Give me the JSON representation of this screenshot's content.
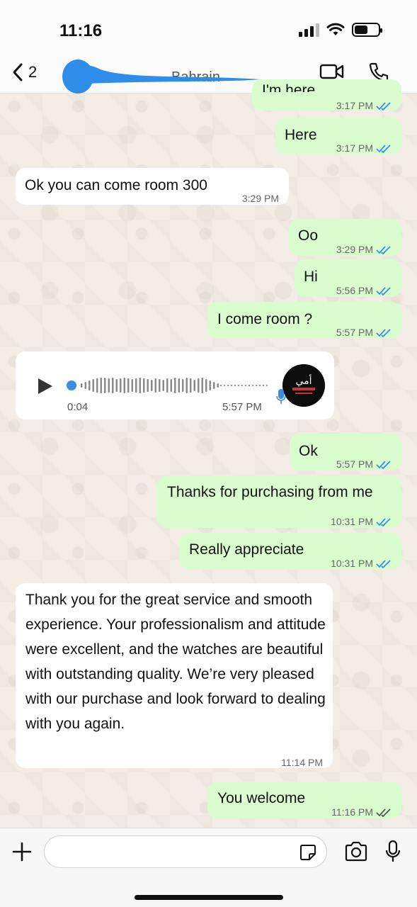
{
  "status_bar": {
    "time": "11:16"
  },
  "header": {
    "back_count": "2",
    "contact_name": "Bahrain"
  },
  "messages": [
    {
      "direction": "out",
      "text": "I'm here",
      "time": "3:17 PM",
      "ticks": "read"
    },
    {
      "direction": "out",
      "text": "Here",
      "time": "3:17 PM",
      "ticks": "read"
    },
    {
      "direction": "in",
      "text": "Ok you can come room 300",
      "time": "3:29 PM"
    },
    {
      "direction": "out",
      "text": "Oo",
      "time": "3:29 PM",
      "ticks": "read"
    },
    {
      "direction": "out",
      "text": "Hi",
      "time": "5:56 PM",
      "ticks": "read"
    },
    {
      "direction": "out",
      "text": "I come room ?",
      "time": "5:57 PM",
      "ticks": "read"
    },
    {
      "direction": "out",
      "text": "Ok",
      "time": "5:57 PM",
      "ticks": "read"
    },
    {
      "direction": "out",
      "text": "Thanks for purchasing from me",
      "time": "10:31 PM",
      "ticks": "read"
    },
    {
      "direction": "out",
      "text": "Really appreciate",
      "time": "10:31 PM",
      "ticks": "read"
    },
    {
      "direction": "in",
      "text": "Thank you for the great service and smooth experience. Your professionalism and attitude were excellent, and the watches are beautiful with outstanding quality. We’re very pleased with our purchase and look forward to dealing with you again.",
      "time": "11:14 PM"
    },
    {
      "direction": "out",
      "text": "You welcome",
      "time": "11:16 PM",
      "ticks": "delivered"
    }
  ],
  "voice_message": {
    "duration": "0:04",
    "time": "5:57 PM",
    "avatar_text": "أمي"
  },
  "colors": {
    "outgoing_bubble": "#dafdd0",
    "incoming_bubble": "#ffffff",
    "read_ticks": "#3b8de0",
    "voice_dot": "#3b8de0"
  },
  "icons": {
    "back": "chevron-left-icon",
    "video": "video-camera-icon",
    "call": "phone-icon",
    "play": "play-icon",
    "mic": "microphone-icon",
    "plus": "plus-icon",
    "sticker": "sticker-icon",
    "camera": "camera-icon"
  }
}
